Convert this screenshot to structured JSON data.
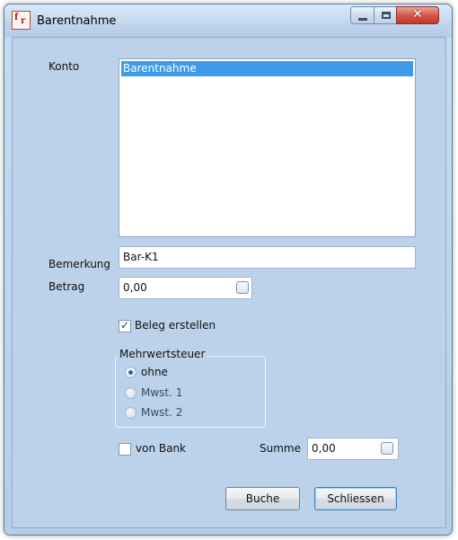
{
  "window": {
    "title": "Barentnahme"
  },
  "form": {
    "konto_label": "Konto",
    "konto_items": [
      "Barentnahme"
    ],
    "bemerkung_label": "Bemerkung",
    "bemerkung_value": "Bar-K1",
    "betrag_label": "Betrag",
    "betrag_value": "0,00",
    "beleg_label": "Beleg erstellen",
    "beleg_checked": true,
    "mwst_group_title": "Mehrwertsteuer",
    "mwst_options": [
      "ohne",
      "Mwst. 1",
      "Mwst. 2"
    ],
    "mwst_selected": "ohne",
    "von_bank_label": "von Bank",
    "von_bank_checked": false,
    "summe_label": "Summe",
    "summe_value": "0,00"
  },
  "buttons": {
    "buche": "Buche",
    "schliessen": "Schliessen"
  },
  "icons": {
    "app": "app-icon",
    "minimize": "minimize-icon",
    "maximize": "maximize-icon",
    "close": "close-icon"
  },
  "colors": {
    "selection": "#3d9be9",
    "close_button": "#c0392b",
    "client_bg": "#bcd2ea"
  }
}
